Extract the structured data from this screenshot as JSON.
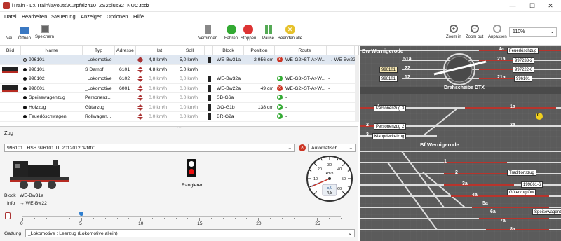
{
  "window": {
    "title": "iTrain - L:\\iTrain\\layouts\\Kurpfalz410_ZS2plus32_NUC.tcdz",
    "minimize": "—",
    "maximize": "☐",
    "close": "✕"
  },
  "menu": [
    "Datei",
    "Bearbeiten",
    "Steuerung",
    "Anzeigen",
    "Optionen",
    "Hilfe"
  ],
  "toolbar": {
    "new": "Neu",
    "open": "Öffnen",
    "save": "Speichern",
    "connect": "Verbinden",
    "run": "Fahren",
    "stop": "Stoppen",
    "pause": "Pause",
    "end_all": "Beenden alle",
    "zoom_in": "Zoom in",
    "zoom_out": "Zoom out",
    "fit": "Anpassen",
    "zoom": "110%"
  },
  "colors": {
    "accent": "#2f7fd0",
    "selected_row": "#dfe7f1",
    "layout_bg": "#5b5b5b",
    "red_track": "#b8342c",
    "run_green": "#3a3",
    "stop_red": "#c32"
  },
  "table": {
    "headers": [
      "Bild",
      "Name",
      "Typ",
      "Adresse",
      "",
      "Ist",
      "Soll",
      "",
      "Block",
      "Position",
      "",
      "Route",
      ""
    ],
    "rows": [
      {
        "name": "996101",
        "typ": "_Lokomotive",
        "adresse": "",
        "ist": "4,8 km/h",
        "soll": "5,0 km/h",
        "block": "WE-Bw31a",
        "position": "2.956 cm",
        "route": "WE-G2>ST-A>W...",
        "ziel": "→ WE-Bw22",
        "sel": true,
        "img": "",
        "btn": "red"
      },
      {
        "name": "996101",
        "typ": "S Dampf",
        "adresse": "6101",
        "ist": "4,8 km/h",
        "soll": "5,0 km/h",
        "block": "",
        "position": "",
        "route": "",
        "ziel": "",
        "sel": false,
        "img": "loco",
        "btn": ""
      },
      {
        "name": "996102",
        "typ": "_Lokomotive",
        "adresse": "6102",
        "ist": "0,0 km/h",
        "soll": "0,0 km/h",
        "block": "WE-Bw32a",
        "position": "",
        "route": "WE-G3>ST-A>W...",
        "ziel": "-",
        "sel": false,
        "img": "",
        "btn": "green"
      },
      {
        "name": "996001",
        "typ": "_Lokomotive",
        "adresse": "6001",
        "ist": "0,0 km/h",
        "soll": "0,0 km/h",
        "block": "WE-Bw22a",
        "position": "49 cm",
        "route": "WE-G2>ST-A>W...",
        "ziel": "-",
        "sel": false,
        "img": "loco",
        "btn": "red"
      },
      {
        "name": "Speisewagenzug",
        "typ": "Personenz...",
        "adresse": "",
        "ist": "0,0 km/h",
        "soll": "0,0 km/h",
        "block": "SB-G6a",
        "position": "",
        "route": "-",
        "ziel": "",
        "sel": false,
        "img": "",
        "btn": "green"
      },
      {
        "name": "Holzzug",
        "typ": "Güterzug",
        "adresse": "",
        "ist": "0,0 km/h",
        "soll": "0,0 km/h",
        "block": "GO-G1b",
        "position": "138 cm",
        "route": "-",
        "ziel": "",
        "sel": false,
        "img": "",
        "btn": "green"
      },
      {
        "name": "Feuerlöschwagen",
        "typ": "Rollwagen...",
        "adresse": "",
        "ist": "0,0 km/h",
        "soll": "0,0 km/h",
        "block": "BR-G2a",
        "position": "",
        "route": "-",
        "ziel": "",
        "sel": false,
        "img": "",
        "btn": "green"
      },
      {
        "name": "",
        "typ": "",
        "adresse": "",
        "ist": "",
        "soll": "",
        "block": "",
        "position": "",
        "route": "",
        "ziel": "",
        "sel": false,
        "img": "",
        "btn": ""
      }
    ]
  },
  "zug": {
    "panel_title": "Zug",
    "train_select": "996101 : HSB 996101 TL 2012012 \"Pfiffi\"",
    "mode": "Automatisch",
    "block_label": "Block",
    "block_value": "WE-Bw31a",
    "info_label": "Info",
    "info_value": "→ WE-Bw22",
    "signal_label": "Rangieren",
    "speed_unit": "km/h",
    "speed_soll": "5,0",
    "speed_ist": "4,8",
    "gauge_ticks": [
      "10",
      "20",
      "30",
      "40",
      "50",
      "60"
    ],
    "slider_ticks": [
      "0",
      "5",
      "10",
      "15",
      "20",
      "25"
    ],
    "slider_value": 5,
    "slider_max": 27,
    "gattung_label": "Gattung",
    "gattung_value": "_Lokomotive : Leerzug (Lokomotive allein)"
  },
  "layout": {
    "title_bw": "Bw Wernigerode",
    "title_bf": "Bf Wernigerode",
    "turntable": "Drehscheibe DTX",
    "tags": [
      "Feuerlöschzug",
      "997233-2",
      "997222-6",
      "996101",
      "996101",
      "996101",
      "Personenzug 3",
      "Personenzug 2",
      "Klappdeckelzug",
      "Traditionszug",
      "199861-6",
      "Güterzug Ow",
      "Speisewagenzug"
    ],
    "numbers": [
      "4a",
      "51a",
      "21a",
      "22",
      "21a",
      "12",
      "1",
      "1a",
      "2",
      "2a",
      "3",
      "1",
      "2",
      "3a",
      "4a",
      "5a",
      "6a",
      "7a",
      "8a",
      "0"
    ]
  }
}
